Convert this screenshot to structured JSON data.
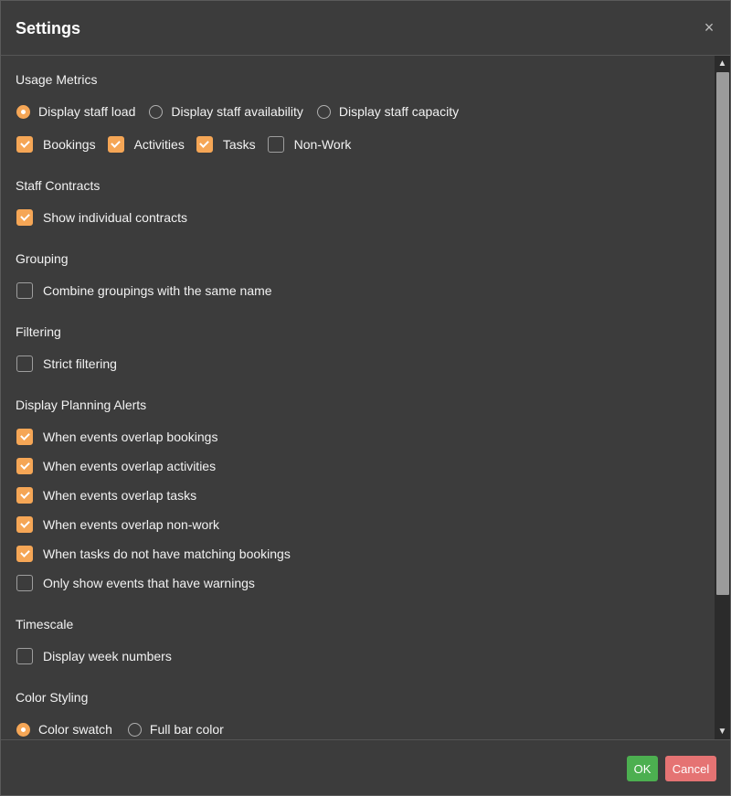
{
  "dialog": {
    "title": "Settings",
    "close_icon": "×"
  },
  "sections": {
    "usage_metrics": {
      "title": "Usage Metrics",
      "radios": [
        {
          "label": "Display staff load",
          "checked": true
        },
        {
          "label": "Display staff availability",
          "checked": false
        },
        {
          "label": "Display staff capacity",
          "checked": false
        }
      ],
      "checks": [
        {
          "label": "Bookings",
          "checked": true
        },
        {
          "label": "Activities",
          "checked": true
        },
        {
          "label": "Tasks",
          "checked": true
        },
        {
          "label": "Non-Work",
          "checked": false
        }
      ]
    },
    "staff_contracts": {
      "title": "Staff Contracts",
      "checks": [
        {
          "label": "Show individual contracts",
          "checked": true
        }
      ]
    },
    "grouping": {
      "title": "Grouping",
      "checks": [
        {
          "label": "Combine groupings with the same name",
          "checked": false
        }
      ]
    },
    "filtering": {
      "title": "Filtering",
      "checks": [
        {
          "label": "Strict filtering",
          "checked": false
        }
      ]
    },
    "planning_alerts": {
      "title": "Display Planning Alerts",
      "checks": [
        {
          "label": "When events overlap bookings",
          "checked": true
        },
        {
          "label": "When events overlap activities",
          "checked": true
        },
        {
          "label": "When events overlap tasks",
          "checked": true
        },
        {
          "label": "When events overlap non-work",
          "checked": true
        },
        {
          "label": "When tasks do not have matching bookings",
          "checked": true
        },
        {
          "label": "Only show events that have warnings",
          "checked": false
        }
      ]
    },
    "timescale": {
      "title": "Timescale",
      "checks": [
        {
          "label": "Display week numbers",
          "checked": false
        }
      ]
    },
    "color_styling": {
      "title": "Color Styling",
      "radios": [
        {
          "label": "Color swatch",
          "checked": true
        },
        {
          "label": "Full bar color",
          "checked": false
        }
      ]
    }
  },
  "footer": {
    "ok_label": "OK",
    "cancel_label": "Cancel"
  },
  "colors": {
    "accent": "#f5a656",
    "ok": "#4caf50",
    "cancel": "#e57373",
    "background": "#3c3c3c"
  },
  "icons": {
    "close": "close-icon",
    "scroll_up": "chevron-up-icon",
    "scroll_down": "chevron-down-icon",
    "check": "checkmark-icon"
  }
}
